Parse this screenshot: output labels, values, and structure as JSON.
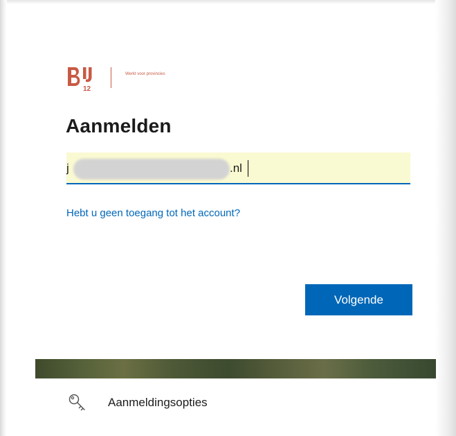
{
  "brand": {
    "logo_text": "BIJ12",
    "tagline": "Werkt voor provincies",
    "color": "#c85a45"
  },
  "signin": {
    "title": "Aanmelden",
    "email_prefix": "j",
    "email_suffix": ".nl",
    "no_access_link": "Hebt u geen toegang tot het account?",
    "next_button": "Volgende"
  },
  "footer": {
    "options_label": "Aanmeldingsopties",
    "options_icon": "key-icon"
  },
  "colors": {
    "accent": "#0067b8",
    "autofill": "#fafad2",
    "text": "#1b1b1b"
  }
}
